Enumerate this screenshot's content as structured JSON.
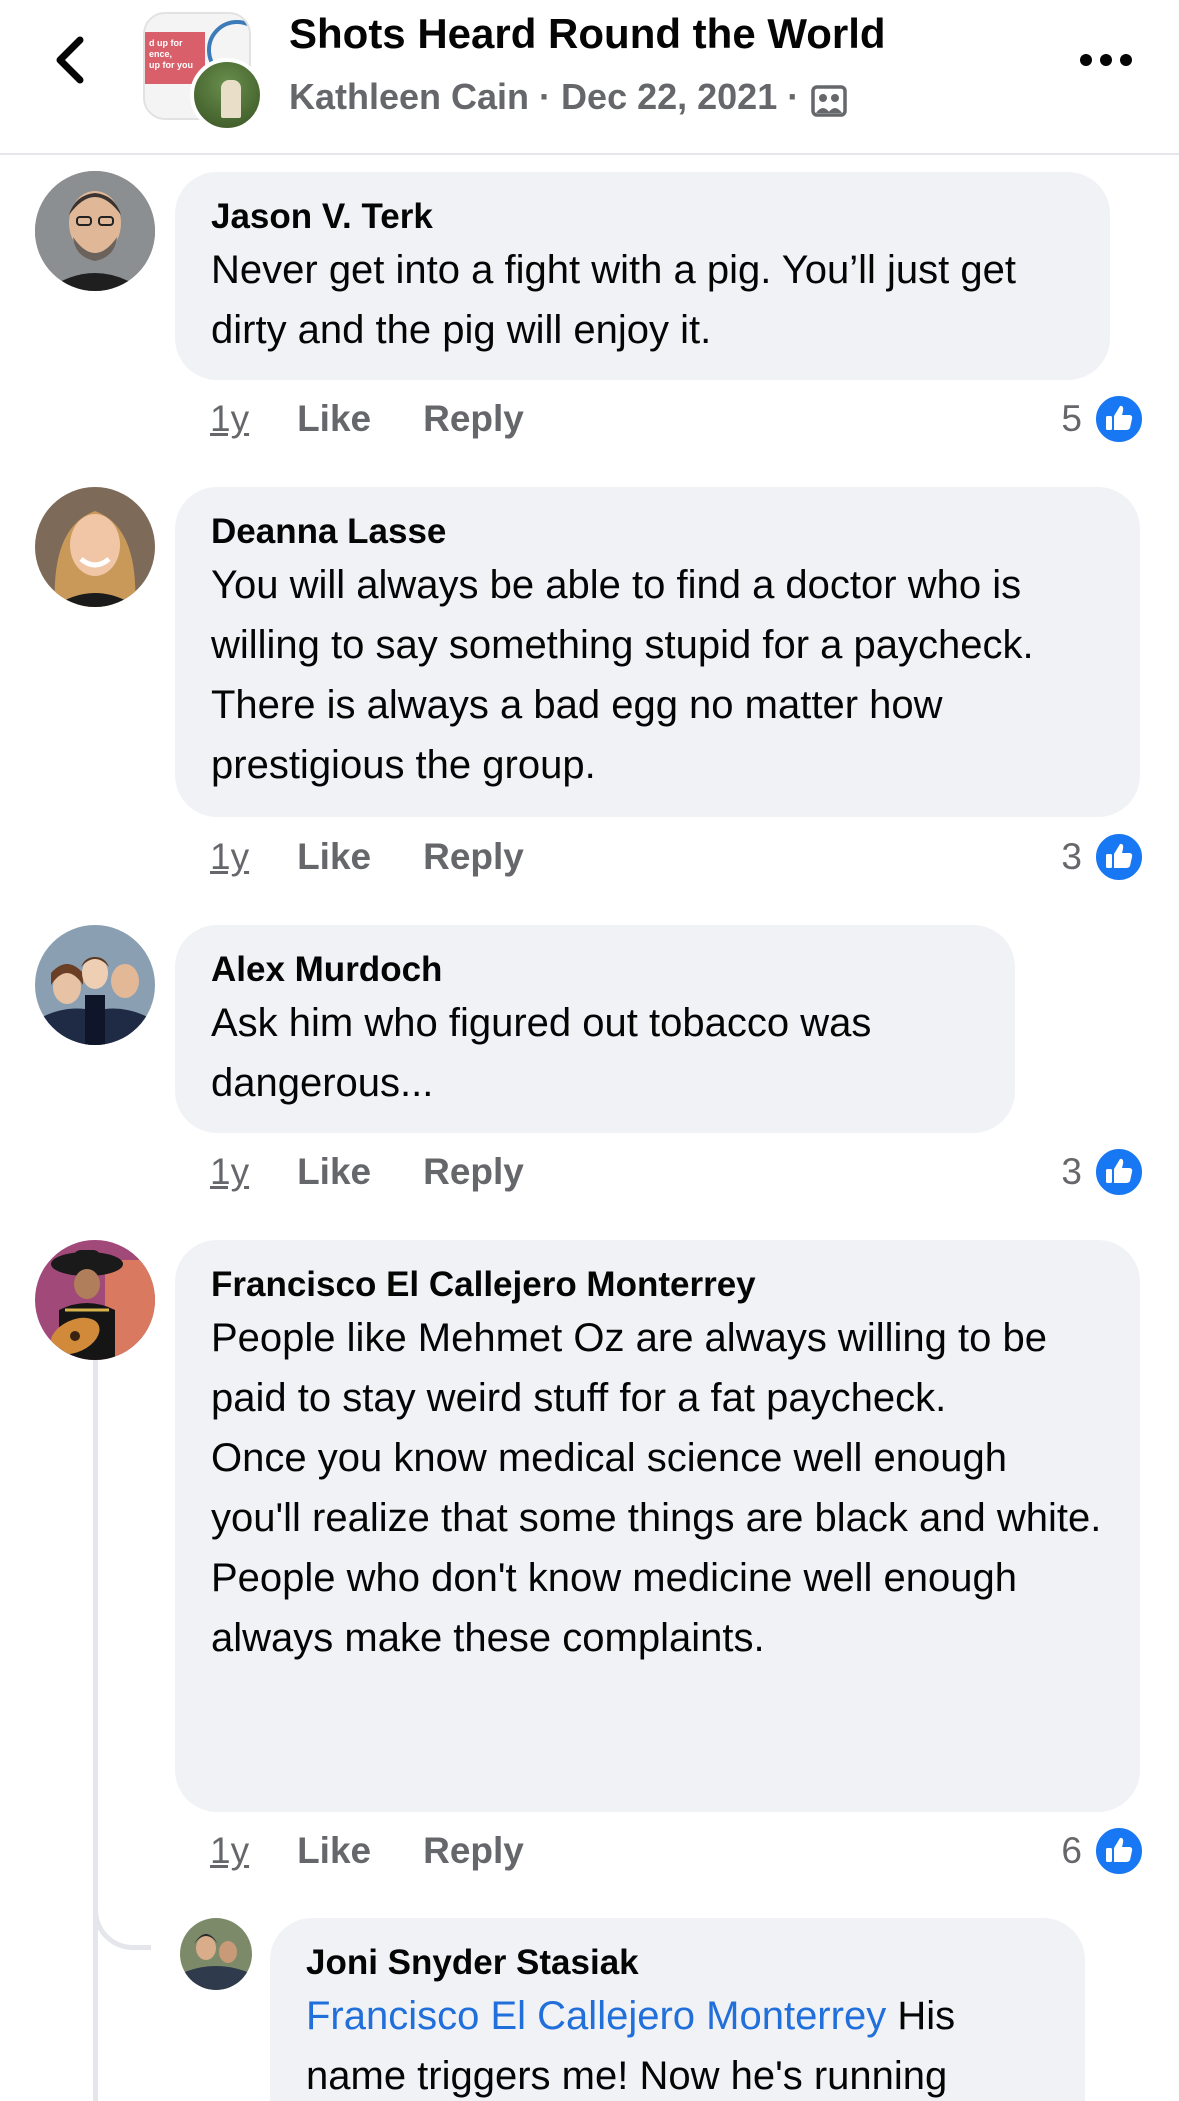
{
  "header": {
    "back_icon": "chevron-left-icon",
    "title": "Shots Heard Round the World",
    "author": "Kathleen Cain",
    "separator": "·",
    "date": "Dec 22, 2021",
    "privacy_icon": "group-icon",
    "more_icon": "more-icon",
    "avatar_text": "d up for\nence,\nup for you"
  },
  "comments": [
    {
      "author": "Jason V. Terk",
      "lines": [
        "Never get into a fight with a pig. You’ll just get dirty and the pig will enjoy it."
      ],
      "time": "1y",
      "like": "Like",
      "reply": "Reply",
      "reactions": "5"
    },
    {
      "author": "Deanna Lasse",
      "lines": [
        "You will always be able to find a doctor who is willing to say something stupid for a paycheck. There is always a bad egg no matter how prestigious the group."
      ],
      "time": "1y",
      "like": "Like",
      "reply": "Reply",
      "reactions": "3"
    },
    {
      "author": "Alex Murdoch",
      "lines": [
        "Ask him who figured out tobacco was dangerous..."
      ],
      "time": "1y",
      "like": "Like",
      "reply": "Reply",
      "reactions": "3"
    },
    {
      "author": "Francisco El Callejero Monterrey",
      "lines": [
        "People like Mehmet Oz are always willing to be paid to stay weird stuff for a fat paycheck.",
        "Once you know medical science well enough you'll realize that some things are black and white. People who don't know medicine well enough always make these complaints."
      ],
      "time": "1y",
      "like": "Like",
      "reply": "Reply",
      "reactions": "6"
    }
  ],
  "reply": {
    "author": "Joni Snyder Stasiak",
    "mention": "Francisco El Callejero Monterrey",
    "text": " His name triggers me! Now he's running"
  },
  "colors": {
    "bubble": "#f0f2f5",
    "like_blue": "#1877f2",
    "mention": "#216fdb",
    "secondary_text": "#65676b"
  }
}
